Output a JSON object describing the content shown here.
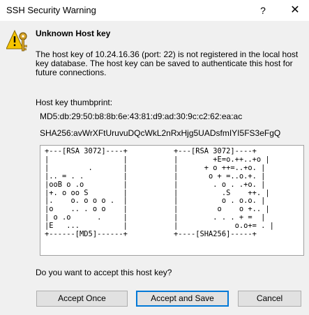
{
  "window": {
    "title": "SSH Security Warning",
    "help_glyph": "?",
    "close_glyph": "✕"
  },
  "icon": {
    "name": "warning-key-icon"
  },
  "heading": "Unknown Host key",
  "message": "The host key of 10.24.16.36 (port: 22) is not registered in the local host key database. The host key can be saved to authenticate this host for future connections.",
  "fingerprint": {
    "label": "Host key thumbprint:",
    "md5": "MD5:db:29:50:b8:8b:6e:43:81:d9:ad:30:9c:c2:62:ea:ac",
    "sha256": "SHA256:avWrXFtUruvuDQcWkL2nRxHjg5UADsfmIYI5FS3eFgQ"
  },
  "randomart": {
    "md5": "+---[RSA 3072]----+\n|                 |\n|         .       |\n|.. = . .         |\n|ooB o .o         |\n|+. o oo S        |\n|.    o. o o o .  |\n|o    .. . o o    |\n| o .o      .     |\n|E   ...          |\n+------[MD5]------+",
    "sha256": "+---[RSA 3072]----+\n|        +E=o.++..+o |\n|      + o ++=..+o. |\n|       o + =..o.+. |\n|        . o . .+o. |\n|          .S    ++. |\n|          o . o.o. |\n|         o    o +.. |\n|        . . . + =  |\n|             o.o+= . |\n+----[SHA256]-----+"
  },
  "question": "Do you want to accept this host key?",
  "buttons": {
    "accept_once": "Accept Once",
    "accept_save": "Accept and Save",
    "cancel": "Cancel"
  },
  "colors": {
    "default_button_border": "#0078d7",
    "dialog_bg": "#f0f0f0"
  }
}
